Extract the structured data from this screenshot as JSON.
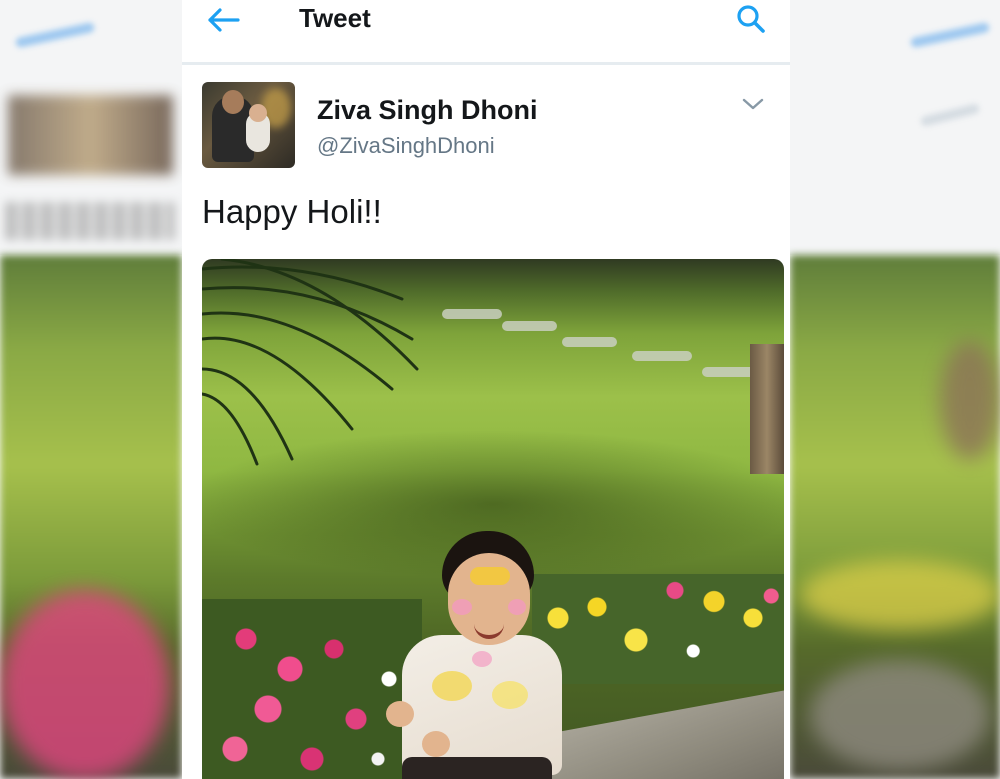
{
  "header": {
    "title": "Tweet",
    "back_icon": "arrow-left-icon",
    "search_icon": "search-icon"
  },
  "tweet": {
    "author_name": "Ziva Singh Dhoni",
    "author_handle": "@ZivaSinghDhoni",
    "text": "Happy Holi!!",
    "menu_icon": "chevron-down-icon"
  },
  "colors": {
    "accent": "#1da1f2",
    "text_primary": "#14171a",
    "text_secondary": "#657786",
    "divider": "#e6ecf0"
  }
}
